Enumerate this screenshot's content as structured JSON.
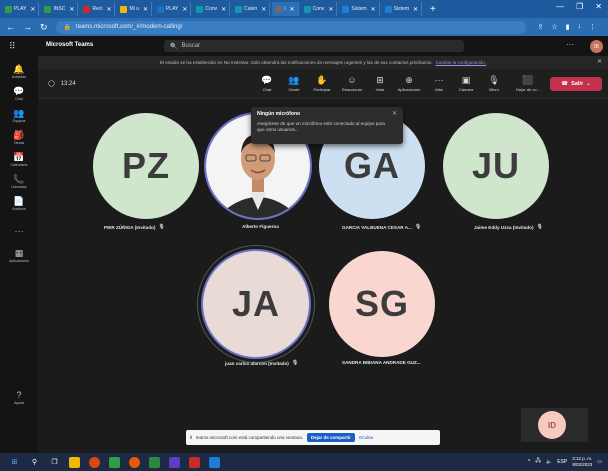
{
  "browser": {
    "tabs": [
      {
        "label": "PLAY",
        "color": "#2f9e44",
        "active": false
      },
      {
        "label": "INSC",
        "color": "#2f9e44",
        "active": false
      },
      {
        "label": "Reci",
        "color": "#c92a2a",
        "active": false
      },
      {
        "label": "Mi u",
        "color": "#f2b705",
        "active": false
      },
      {
        "label": "PLAY",
        "color": "#1971c2",
        "active": false
      },
      {
        "label": "Conv",
        "color": "#1098ad",
        "active": false
      },
      {
        "label": "Calen",
        "color": "#1098ad",
        "active": false
      },
      {
        "label": "I",
        "color": "#6c6c6c",
        "active": true
      },
      {
        "label": "Conv",
        "color": "#1098ad",
        "active": false
      },
      {
        "label": "Sistem",
        "color": "#1c7ed6",
        "active": false
      },
      {
        "label": "Sistem",
        "color": "#1c7ed6",
        "active": false
      }
    ],
    "new_tab": "+",
    "url": "teams.microsoft.com/_#/modern-calling/"
  },
  "teams": {
    "brand": "Microsoft Teams",
    "search_placeholder": "Buscar",
    "user_initials": "IB"
  },
  "rail": [
    {
      "icon": "bell-icon",
      "glyph": "🔔",
      "label": "Actividad"
    },
    {
      "icon": "chat-icon",
      "glyph": "💬",
      "label": "Chat"
    },
    {
      "icon": "teams-icon",
      "glyph": "👥",
      "label": "Equipos"
    },
    {
      "icon": "tasks-icon",
      "glyph": "🎒",
      "label": "Tareas"
    },
    {
      "icon": "calendar-icon",
      "glyph": "📅",
      "label": "Calendario"
    },
    {
      "icon": "calls-icon",
      "glyph": "📞",
      "label": "Llamadas"
    },
    {
      "icon": "files-icon",
      "glyph": "📄",
      "label": "Archivos"
    },
    {
      "icon": "more-icon",
      "glyph": "···",
      "label": ""
    },
    {
      "icon": "apps-icon",
      "glyph": "▦",
      "label": "Aplicaciones"
    },
    {
      "icon": "help-icon",
      "glyph": "?",
      "label": "Ayuda"
    }
  ],
  "notification": {
    "text": "El estado se ha establecido en No molestar. Solo obtendrá las notificaciones de mensajes urgentes y las de sus contactos prioritarios.",
    "link": "Cambie la configuración."
  },
  "call": {
    "timer": "13:24",
    "controls": [
      {
        "icon": "chat-icon",
        "glyph": "💬",
        "label": "Chat"
      },
      {
        "icon": "people-icon",
        "glyph": "👥",
        "label": "Gente"
      },
      {
        "icon": "raise-hand-icon",
        "glyph": "✋",
        "label": "Participar"
      },
      {
        "icon": "react-icon",
        "glyph": "☺",
        "label": "Reaccionar"
      },
      {
        "icon": "view-icon",
        "glyph": "⊞",
        "label": "Vista"
      },
      {
        "icon": "apps-icon",
        "glyph": "⊕",
        "label": "Aplicaciones"
      },
      {
        "icon": "more-icon",
        "glyph": "···",
        "label": "Más"
      }
    ],
    "camera_label": "Cámara",
    "mic_label": "Micro",
    "share_label": "Dejar de co...",
    "leave_label": "Salir"
  },
  "popup": {
    "title": "Ningún micrófono",
    "body": "Asegúrese de que un micrófono esté conectado al equipo para que otros usuarios..."
  },
  "participants": [
    {
      "initials": "PZ",
      "name": "PIER ZÚÑIGA (Invitado)",
      "bg": "#cfe5cc",
      "photo": false
    },
    {
      "initials": "",
      "name": "Alberto Figueroa",
      "bg": "#ffffff",
      "photo": true
    },
    {
      "initials": "GA",
      "name": "GARCIA VALBUENA CESAR A...",
      "bg": "#cde0f2",
      "photo": false
    },
    {
      "initials": "JU",
      "name": "Jaime Eddy Uzsa (Invitado)",
      "bg": "#cfe5cc",
      "photo": false
    },
    {
      "initials": "JA",
      "name": "juan carlos alarcon (Invitado)",
      "bg": "#e8dbd6",
      "photo": false
    },
    {
      "initials": "SG",
      "name": "SANDRA BIBIANA ANDRADE GUZ...",
      "bg": "#f9d6cf",
      "photo": false
    }
  ],
  "self_view": {
    "initials": "ID"
  },
  "share_banner": {
    "text": "teams.microsoft.com está compartiendo una ventana.",
    "stop": "Dejar de compartir",
    "hide": "Ocultar"
  },
  "taskbar": {
    "lang": "ESP",
    "time": "3:12 p. m.",
    "date": "9/02/2023"
  },
  "colors": {
    "accent": "#6b70c9",
    "leave": "#c4314b",
    "browser": "#1e5a9e"
  }
}
